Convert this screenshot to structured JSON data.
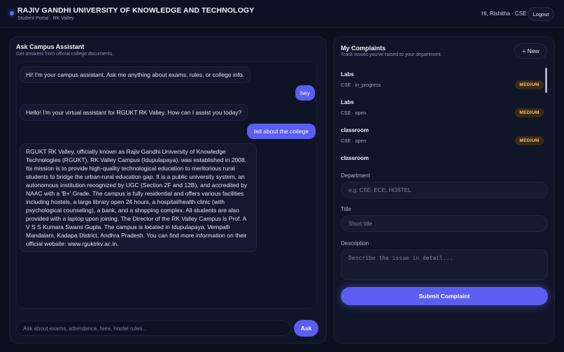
{
  "header": {
    "title": "RAJIV GANDHI UNIVERSITY OF KNOWLEDGE AND TECHNOLOGY",
    "subtitle": "Student Portal · RK Valley",
    "user": "Hi, Rishitha · CSE ·",
    "logout_label": "Logout"
  },
  "chat": {
    "title": "Ask Campus Assistant",
    "subtitle": "Get answers from official college documents.",
    "messages": [
      {
        "role": "bot",
        "text": "Hi! I'm your campus assistant. Ask me anything about exams, rules, or college info."
      },
      {
        "role": "user",
        "text": "hey"
      },
      {
        "role": "bot",
        "text": "Hello! I'm your virtual assistant for RGUKT RK Valley. How can I assist you today?"
      },
      {
        "role": "user",
        "text": "tell about the college"
      },
      {
        "role": "bot",
        "text": "RGUKT RK Valley, officially known as Rajiv Gandhi University of Knowledge Technologies (RGUKT), RK Valley Campus (Idupulapaya), was established in 2008. Its mission is to provide high-quality technological education to meritorious rural students to bridge the urban-rural education gap. It is a public university system, an autonomous institution recognized by UGC (Section 2F and 12B), and accredited by NAAC with a 'B+' Grade. The campus is fully residential and offers various facilities including hostels, a large library open 24 hours, a hospital/health clinic (with psychological counseling), a bank, and a shopping complex. All students are also provided with a laptop upon joining. The Director of the RK Valley Campus is Prof. A V S S Kumara Swami Gupta. The campus is located in Idupulapaya, Vempalli Mandalam, Kadapa District, Andhra Pradesh. You can find more information on their official website: www.rguktrkv.ac.in."
      }
    ],
    "input_placeholder": "Ask about exams, attendance, fees, hostel rules...",
    "ask_label": "Ask"
  },
  "complaints": {
    "title": "My Complaints",
    "subtitle": "Track issues you've raised to your department.",
    "new_label": "+ New",
    "items": [
      {
        "title": "Labs",
        "meta": "CSE · in_progress",
        "priority": "MEDIUM"
      },
      {
        "title": "Labs",
        "meta": "CSE · open",
        "priority": "MEDIUM"
      },
      {
        "title": "classroom",
        "meta": "CSE · open",
        "priority": "MEDIUM"
      },
      {
        "title": "classroom",
        "meta": "",
        "priority": ""
      }
    ],
    "form": {
      "department_label": "Department",
      "department_placeholder": "e.g. CSE, ECE, HOSTEL",
      "title_label": "Title",
      "title_placeholder": "Short title",
      "description_label": "Description",
      "description_placeholder": "Describe the issue in detail...",
      "submit_label": "Submit Complaint"
    }
  },
  "colors": {
    "accent": "#5b5ef0",
    "background": "#0b0f1e",
    "panel": "#101528",
    "badge_medium": "#f2c27a"
  }
}
